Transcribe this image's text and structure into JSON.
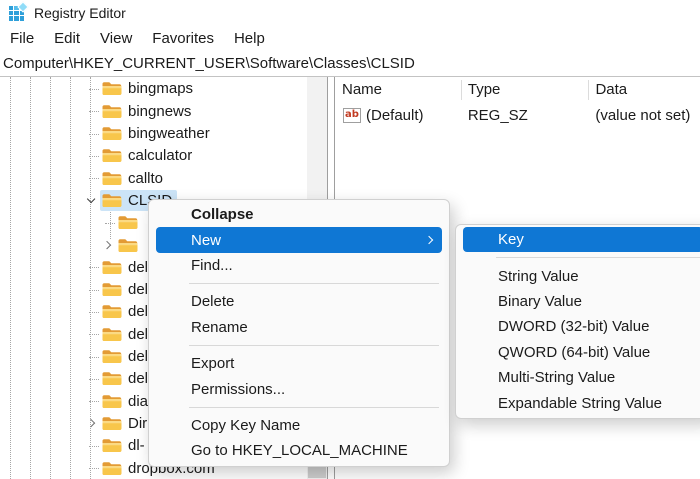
{
  "window": {
    "title": "Registry Editor"
  },
  "menubar": {
    "items": [
      "File",
      "Edit",
      "View",
      "Favorites",
      "Help"
    ]
  },
  "address_bar": {
    "value": "Computer\\HKEY_CURRENT_USER\\Software\\Classes\\CLSID"
  },
  "tree": {
    "items": [
      {
        "label": "bingmaps",
        "level": 0,
        "chevron": "none",
        "selected": false
      },
      {
        "label": "bingnews",
        "level": 0,
        "chevron": "none",
        "selected": false
      },
      {
        "label": "bingweather",
        "level": 0,
        "chevron": "none",
        "selected": false
      },
      {
        "label": "calculator",
        "level": 0,
        "chevron": "none",
        "selected": false
      },
      {
        "label": "callto",
        "level": 0,
        "chevron": "none",
        "selected": false
      },
      {
        "label": "CLSID",
        "level": 0,
        "chevron": "expanded",
        "selected": true
      },
      {
        "label": "",
        "level": 1,
        "chevron": "none",
        "selected": false
      },
      {
        "label": "",
        "level": 1,
        "chevron": "collapsed",
        "selected": false
      },
      {
        "label": "del",
        "level": 0,
        "chevron": "none",
        "selected": false
      },
      {
        "label": "del",
        "level": 0,
        "chevron": "none",
        "selected": false
      },
      {
        "label": "del",
        "level": 0,
        "chevron": "none",
        "selected": false
      },
      {
        "label": "del",
        "level": 0,
        "chevron": "none",
        "selected": false
      },
      {
        "label": "del",
        "level": 0,
        "chevron": "none",
        "selected": false
      },
      {
        "label": "del",
        "level": 0,
        "chevron": "none",
        "selected": false
      },
      {
        "label": "dia",
        "level": 0,
        "chevron": "none",
        "selected": false
      },
      {
        "label": "Dir",
        "level": 0,
        "chevron": "collapsed",
        "selected": false
      },
      {
        "label": "dl-",
        "level": 0,
        "chevron": "none",
        "selected": false
      },
      {
        "label": "dropbox.com",
        "level": 0,
        "chevron": "none",
        "selected": false
      }
    ]
  },
  "list": {
    "columns": [
      "Name",
      "Type",
      "Data"
    ],
    "rows": [
      {
        "icon": "string-value-icon",
        "icon_text": "ab",
        "name": "(Default)",
        "type": "REG_SZ",
        "data": "(value not set)"
      }
    ]
  },
  "context_menu": {
    "items": [
      {
        "label": "Collapse",
        "bold": true
      },
      {
        "label": "New",
        "highlighted": true,
        "submenu_arrow": true
      },
      {
        "label": "Find..."
      },
      {
        "separator": true
      },
      {
        "label": "Delete"
      },
      {
        "label": "Rename"
      },
      {
        "separator": true
      },
      {
        "label": "Export"
      },
      {
        "label": "Permissions..."
      },
      {
        "separator": true
      },
      {
        "label": "Copy Key Name"
      },
      {
        "label": "Go to HKEY_LOCAL_MACHINE"
      }
    ]
  },
  "submenu": {
    "items": [
      {
        "label": "Key",
        "highlighted": true
      },
      {
        "separator": true
      },
      {
        "label": "String Value"
      },
      {
        "label": "Binary Value"
      },
      {
        "label": "DWORD (32-bit) Value"
      },
      {
        "label": "QWORD (64-bit) Value"
      },
      {
        "label": "Multi-String Value"
      },
      {
        "label": "Expandable String Value"
      }
    ]
  },
  "colors": {
    "accent": "#0f77d4",
    "tree_selection": "#cce4f7"
  }
}
